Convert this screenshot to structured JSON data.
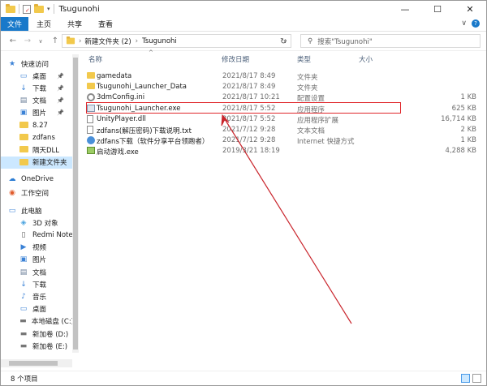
{
  "window": {
    "title": "Tsugunohi"
  },
  "ribbon": {
    "tabs": [
      "文件",
      "主页",
      "共享",
      "查看"
    ]
  },
  "address": {
    "path": [
      "新建文件夹 (2)",
      "Tsugunohi"
    ],
    "search_placeholder": "搜索\"Tsugunohi\""
  },
  "sidebar": {
    "items": [
      {
        "label": "快速访问",
        "icon": "star-icon"
      },
      {
        "label": "桌面",
        "icon": "desktop-icon",
        "pinned": true
      },
      {
        "label": "下载",
        "icon": "download-icon",
        "pinned": true
      },
      {
        "label": "文档",
        "icon": "document-icon",
        "pinned": true
      },
      {
        "label": "图片",
        "icon": "picture-icon",
        "pinned": true
      },
      {
        "label": "8.27",
        "icon": "folder-icon"
      },
      {
        "label": "zdfans",
        "icon": "folder-icon"
      },
      {
        "label": "隔天DLL",
        "icon": "folder-icon"
      },
      {
        "label": "新建文件夹",
        "icon": "folder-icon"
      },
      {
        "label": "OneDrive",
        "icon": "cloud-icon"
      },
      {
        "label": "工作空间",
        "icon": "workspace-icon"
      },
      {
        "label": "此电脑",
        "icon": "computer-icon"
      },
      {
        "label": "3D 对象",
        "icon": "cube-icon"
      },
      {
        "label": "Redmi Note",
        "icon": "phone-icon"
      },
      {
        "label": "视频",
        "icon": "video-icon"
      },
      {
        "label": "图片",
        "icon": "picture-icon"
      },
      {
        "label": "文档",
        "icon": "document-icon"
      },
      {
        "label": "下载",
        "icon": "download-icon"
      },
      {
        "label": "音乐",
        "icon": "music-icon"
      },
      {
        "label": "桌面",
        "icon": "desktop-icon"
      },
      {
        "label": "本地磁盘 (C:)",
        "icon": "drive-icon"
      },
      {
        "label": "新加卷 (D:)",
        "icon": "drive-icon"
      },
      {
        "label": "新加卷 (E:)",
        "icon": "drive-icon"
      }
    ]
  },
  "columns": {
    "name": "名称",
    "date": "修改日期",
    "type": "类型",
    "size": "大小"
  },
  "files": [
    {
      "name": "gamedata",
      "date": "2021/8/17 8:49",
      "type": "文件夹",
      "size": "",
      "icon": "folder"
    },
    {
      "name": "Tsugunohi_Launcher_Data",
      "date": "2021/8/17 8:49",
      "type": "文件夹",
      "size": "",
      "icon": "folder"
    },
    {
      "name": "3dmConfig.ini",
      "date": "2021/8/17 10:21",
      "type": "配置设置",
      "size": "1 KB",
      "icon": "gear"
    },
    {
      "name": "Tsugunohi_Launcher.exe",
      "date": "2021/8/17 5:52",
      "type": "应用程序",
      "size": "625 KB",
      "icon": "exe"
    },
    {
      "name": "UnityPlayer.dll",
      "date": "2021/8/17 5:52",
      "type": "应用程序扩展",
      "size": "16,714 KB",
      "icon": "doc"
    },
    {
      "name": "zdfans(解压密码)下载说明.txt",
      "date": "2021/7/12 9:28",
      "type": "文本文档",
      "size": "2 KB",
      "icon": "doc"
    },
    {
      "name": "zdfans下载（软件分享平台领跑者）",
      "date": "2021/7/12 9:28",
      "type": "Internet 快捷方式",
      "size": "1 KB",
      "icon": "web"
    },
    {
      "name": "启动游戏.exe",
      "date": "2019/3/21 18:19",
      "type": "",
      "size": "4,288 KB",
      "icon": "game"
    }
  ],
  "status": {
    "count": "8 个项目"
  },
  "colors": {
    "accent": "#1979ca",
    "highlight": "#e0262a",
    "selected": "#cce8ff"
  }
}
